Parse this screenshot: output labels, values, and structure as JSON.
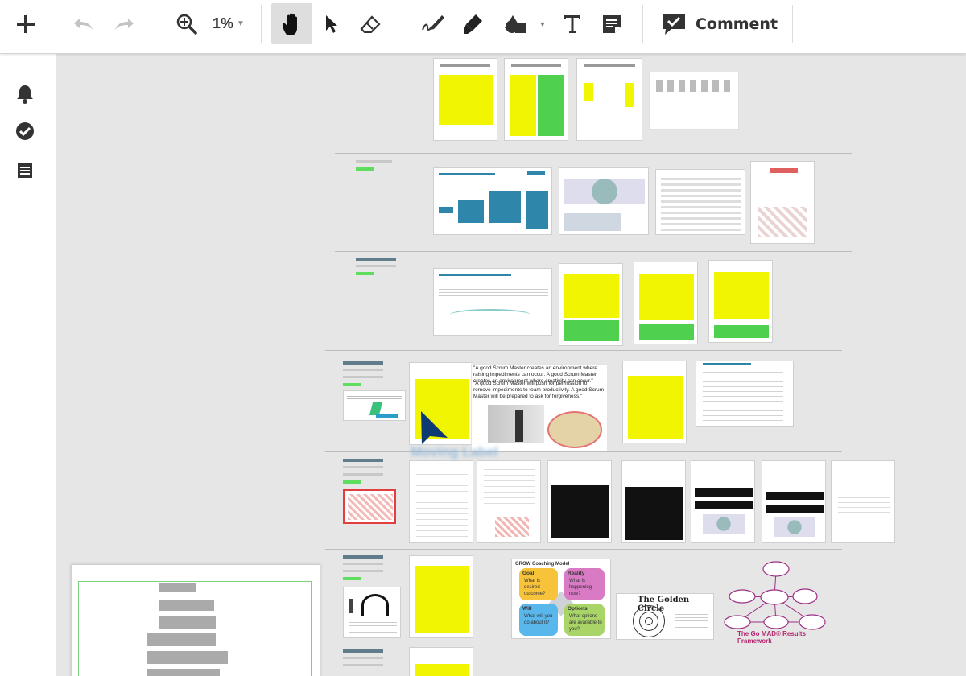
{
  "toolbar": {
    "zoom_level": "1%",
    "comment_label": "Comment",
    "buttons": [
      {
        "name": "add-button",
        "icon": "plus-icon"
      },
      {
        "name": "undo-button",
        "icon": "undo-icon"
      },
      {
        "name": "redo-button",
        "icon": "redo-icon"
      },
      {
        "name": "zoom-button",
        "icon": "zoom-in-icon"
      },
      {
        "name": "hand-tool-button",
        "icon": "hand-icon",
        "active": true
      },
      {
        "name": "select-tool-button",
        "icon": "cursor-arrow-icon"
      },
      {
        "name": "eraser-tool-button",
        "icon": "eraser-icon"
      },
      {
        "name": "pen-tool-button",
        "icon": "pen-icon"
      },
      {
        "name": "highlighter-tool-button",
        "icon": "highlighter-icon"
      },
      {
        "name": "shapes-tool-button",
        "icon": "shapes-icon"
      },
      {
        "name": "text-tool-button",
        "icon": "text-icon"
      },
      {
        "name": "note-tool-button",
        "icon": "sticky-note-icon"
      },
      {
        "name": "comment-button",
        "icon": "comment-icon"
      }
    ]
  },
  "sidebar": {
    "items": [
      {
        "name": "notifications",
        "icon": "bell-icon"
      },
      {
        "name": "tasks",
        "icon": "check-circle-icon"
      },
      {
        "name": "list",
        "icon": "list-icon"
      }
    ]
  },
  "board": {
    "quote_1": "\"A good Scrum Master creates an environment where raising impediments can occur. A good Scrum Master creates an environment where creativity can occur.\"",
    "quote_2": "\"A good Scrum Master will push for permission to remove impediments to team productivity. A good Scrum Master will be prepared to ask for forgiveness.\"",
    "golden_circle_title": "The Golden Circle",
    "framework_title": "The Go MAD® Results Framework",
    "grow_title": "GROW Coaching Model",
    "grow_goal": "Goal",
    "grow_goal_text": "What is desired outcome?",
    "grow_reality": "Reality",
    "grow_reality_text": "What is happening now?",
    "grow_will": "Will",
    "grow_will_text": "What will you do about it?",
    "grow_options": "Options",
    "grow_options_text": "What options are available to you?",
    "cursor_label": "Moving Label"
  },
  "colors": {
    "accent_yellow": "#f1f500",
    "accent_green": "#4fd14f",
    "header_blue": "#2e86ab",
    "tag_slate": "#607d8b",
    "framework_magenta": "#b5266e"
  }
}
